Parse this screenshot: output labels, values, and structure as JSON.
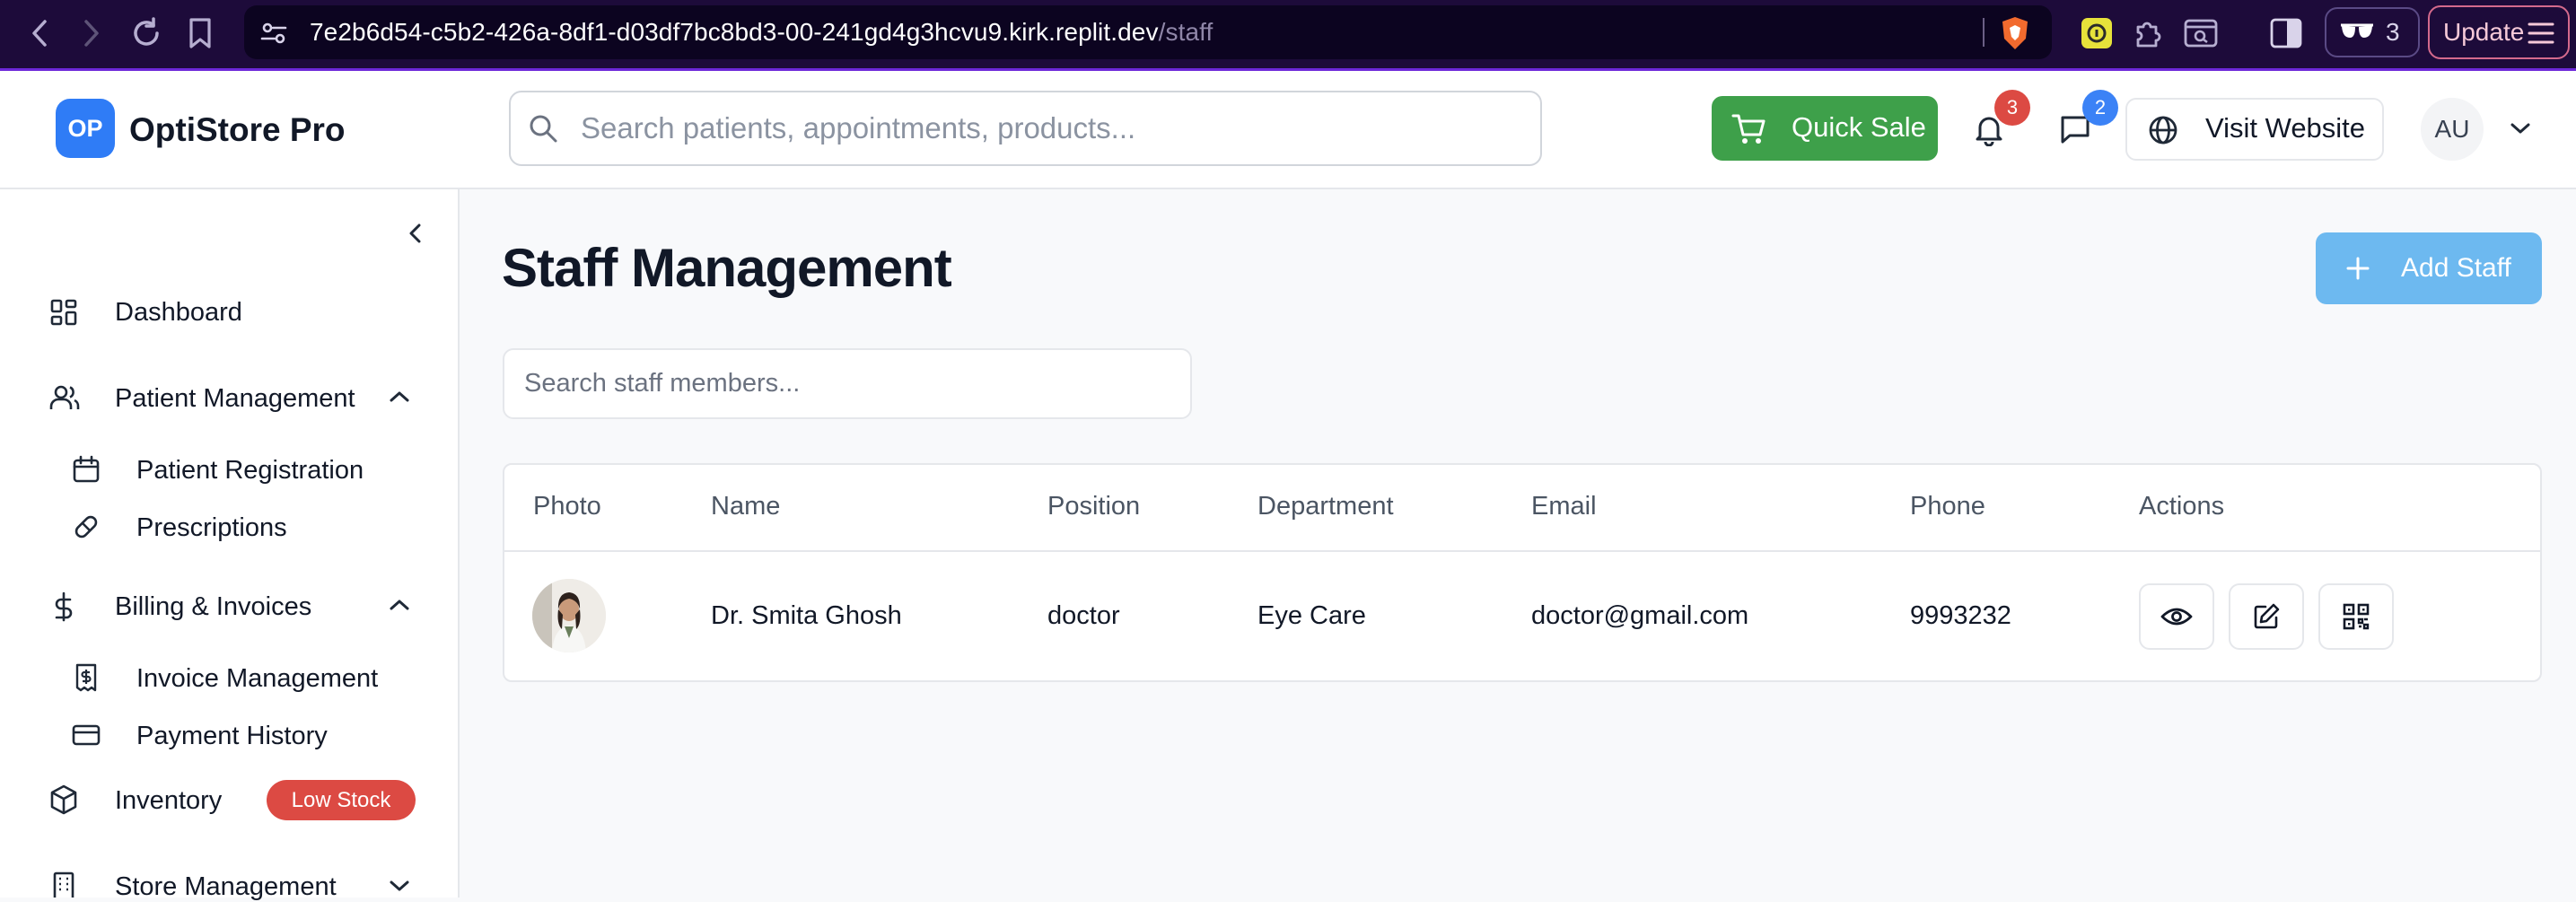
{
  "browser": {
    "url_host": "7e2b6d54-c5b2-426a-8df1-d03df7bc8bd3-00-241gd4g3hcvu9.kirk.replit.dev",
    "url_path": "/staff",
    "extension_count": "3",
    "update_label": "Update"
  },
  "header": {
    "logo_initials": "OP",
    "brand_name": "OptiStore Pro",
    "search_placeholder": "Search patients, appointments, products...",
    "quick_sale_label": "Quick Sale",
    "notifications_count": "3",
    "messages_count": "2",
    "visit_website_label": "Visit Website",
    "user_initials": "AU"
  },
  "sidebar": {
    "items": {
      "dashboard": "Dashboard",
      "patient_management": "Patient Management",
      "patient_registration": "Patient Registration",
      "prescriptions": "Prescriptions",
      "billing_invoices": "Billing & Invoices",
      "invoice_management": "Invoice Management",
      "payment_history": "Payment History",
      "inventory": "Inventory",
      "inventory_badge": "Low Stock",
      "store_management": "Store Management"
    }
  },
  "main": {
    "title": "Staff Management",
    "add_staff_label": "Add Staff",
    "search_placeholder": "Search staff members...",
    "table": {
      "columns": {
        "photo": "Photo",
        "name": "Name",
        "position": "Position",
        "department": "Department",
        "email": "Email",
        "phone": "Phone",
        "actions": "Actions"
      },
      "rows": [
        {
          "name": "Dr. Smita Ghosh",
          "position": "doctor",
          "department": "Eye Care",
          "email": "doctor@gmail.com",
          "phone": "9993232"
        }
      ]
    }
  },
  "colors": {
    "primary": "#2f7cf6",
    "success": "#3ea04a",
    "danger": "#dc4a43",
    "add_button": "#6db9f0",
    "browser_bar": "#1d0b3a"
  },
  "icons": {
    "back": "chevron-left-icon",
    "forward": "chevron-right-icon",
    "reload": "reload-icon",
    "bookmark": "bookmark-icon",
    "site_settings": "sliders-icon",
    "shield": "brave-shield-icon",
    "search": "search-icon",
    "cart": "cart-icon",
    "bell": "bell-icon",
    "message": "message-icon",
    "globe": "globe-icon",
    "view": "eye-icon",
    "edit": "edit-icon",
    "qr": "qr-code-icon"
  }
}
